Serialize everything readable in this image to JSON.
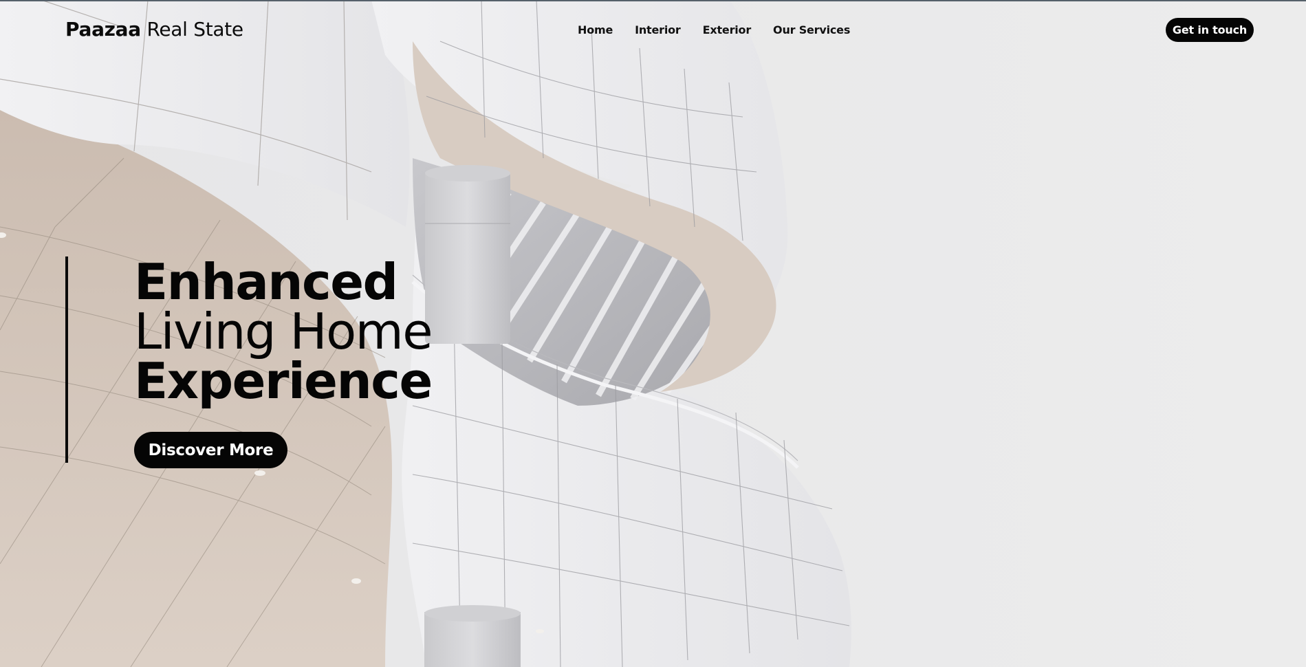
{
  "brand": {
    "bold": "Paazaa",
    "light": "Real State"
  },
  "nav": {
    "items": [
      {
        "label": "Home"
      },
      {
        "label": "Interior"
      },
      {
        "label": "Exterior"
      },
      {
        "label": "Our Services"
      }
    ]
  },
  "header": {
    "cta_label": "Get in touch"
  },
  "hero": {
    "line1": "Enhanced",
    "line2": "Living Home",
    "line3": "Experience",
    "cta_label": "Discover More"
  },
  "colors": {
    "accent": "#050505",
    "background": "#e9e9ea",
    "ceiling_beige": "#d3c6ba",
    "facade_white": "#eaeaec"
  }
}
